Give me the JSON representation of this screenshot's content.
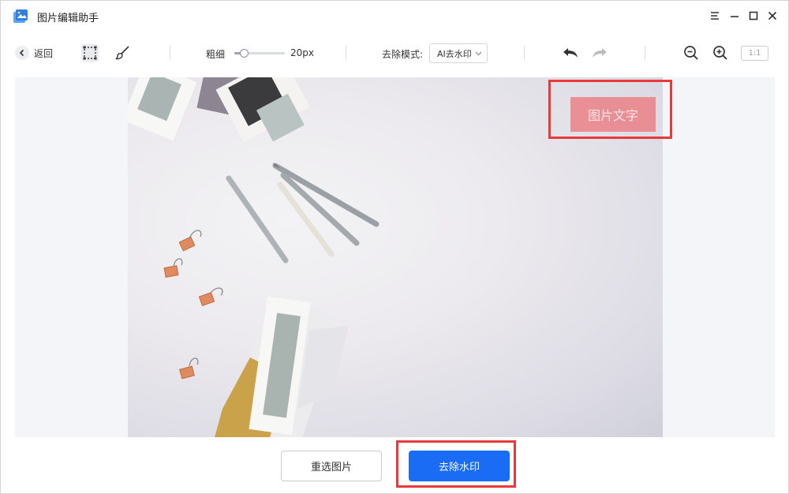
{
  "app": {
    "title": "图片编辑助手"
  },
  "toolbar": {
    "back_label": "返回",
    "brush_size_label": "粗细",
    "brush_size_value": "20px",
    "brush_size_fraction": 0.2,
    "mode_label": "去除模式:",
    "mode_value": "AI去水印",
    "ratio_label": "1:1"
  },
  "canvas": {
    "watermark_text": "图片文字"
  },
  "actions": {
    "reselect_label": "重选图片",
    "remove_label": "去除水印"
  },
  "colors": {
    "primary": "#1a6cf5",
    "highlight": "#e8393b",
    "watermark": "#eb787d"
  },
  "icons": [
    "app-logo-icon",
    "menu-icon",
    "minimize-icon",
    "maximize-icon",
    "close-icon",
    "back-icon",
    "rect-select-icon",
    "brush-icon",
    "undo-icon",
    "redo-icon",
    "zoom-out-icon",
    "zoom-in-icon"
  ]
}
